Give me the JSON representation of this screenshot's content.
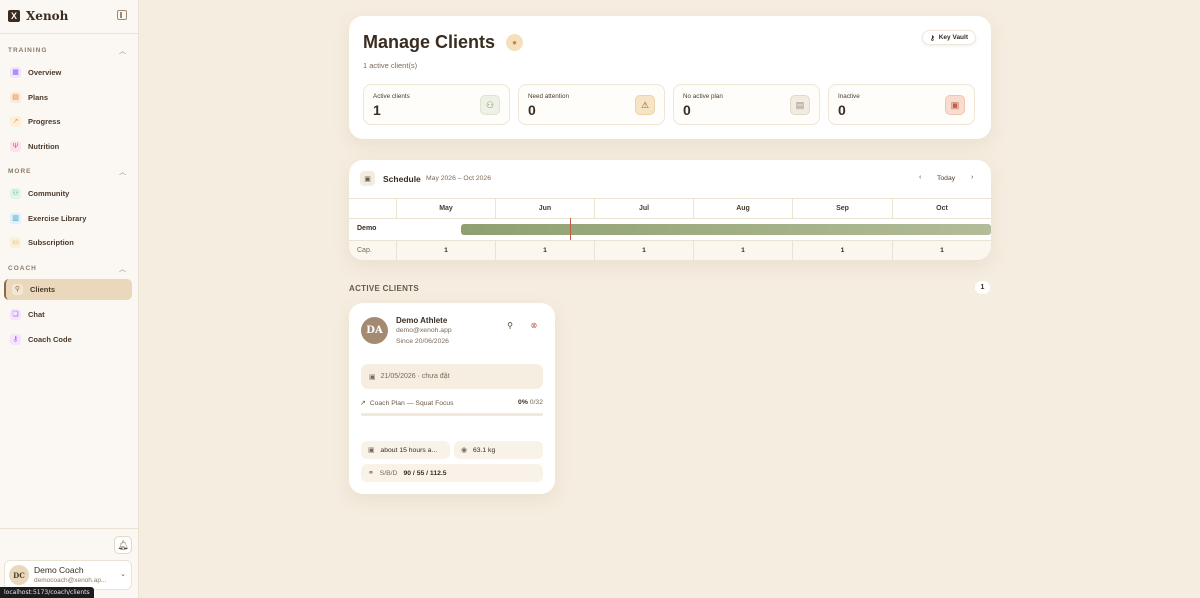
{
  "brand": {
    "name": "Xenoh",
    "logo_letter": "X"
  },
  "sidebar": {
    "sections": [
      {
        "label": "TRAINING",
        "items": [
          {
            "label": "Overview",
            "icon": "grid-icon",
            "color": "#8b5cf6"
          },
          {
            "label": "Plans",
            "icon": "clipboard-icon",
            "color": "#e8823a"
          },
          {
            "label": "Progress",
            "icon": "trending-icon",
            "color": "#e8a23a"
          },
          {
            "label": "Nutrition",
            "icon": "utensils-icon",
            "color": "#e0508a"
          }
        ]
      },
      {
        "label": "MORE",
        "items": [
          {
            "label": "Community",
            "icon": "users-icon",
            "color": "#4caf70"
          },
          {
            "label": "Exercise Library",
            "icon": "book-icon",
            "color": "#3aa0c8"
          },
          {
            "label": "Subscription",
            "icon": "card-icon",
            "color": "#e8a23a"
          }
        ]
      },
      {
        "label": "COACH",
        "items": [
          {
            "label": "Clients",
            "icon": "user-check-icon",
            "color": "#8b6a43",
            "active": true
          },
          {
            "label": "Chat",
            "icon": "chat-icon",
            "color": "#a855f7"
          },
          {
            "label": "Coach Code",
            "icon": "key-icon",
            "color": "#a855f7"
          }
        ]
      }
    ]
  },
  "user": {
    "initials": "DC",
    "name": "Demo Coach",
    "email": "democoach@xenoh.ap..."
  },
  "status_url": "localhost:5173/coach/clients",
  "manage": {
    "title": "Manage Clients",
    "subtitle": "1 active client(s)",
    "key_vault": "Key Vault",
    "stats": [
      {
        "label": "Active clients",
        "value": "1",
        "icon": "users-icon",
        "bg": "#eef1e6",
        "fg": "#7a9a60"
      },
      {
        "label": "Need attention",
        "value": "0",
        "icon": "alert-icon",
        "bg": "#f6e4c6",
        "fg": "#b8802a"
      },
      {
        "label": "No active plan",
        "value": "0",
        "icon": "clipboard-icon",
        "bg": "#f1ebe2",
        "fg": "#9a8a78"
      },
      {
        "label": "Inactive",
        "value": "0",
        "icon": "calendar-icon",
        "bg": "#f7dccf",
        "fg": "#c0604a"
      }
    ]
  },
  "schedule": {
    "title": "Schedule",
    "range": "May 2026 – Oct 2026",
    "today": "Today",
    "months": [
      "May",
      "Jun",
      "Jul",
      "Aug",
      "Sep",
      "Oct"
    ],
    "row_label": "Demo",
    "cap_label": "Cap.",
    "capacities": [
      "1",
      "1",
      "1",
      "1",
      "1",
      "1"
    ]
  },
  "active": {
    "heading": "ACTIVE CLIENTS",
    "count": "1"
  },
  "client": {
    "initials": "DA",
    "name": "Demo Athlete",
    "email": "demo@xenoh.app",
    "since": "Since 20/06/2026",
    "date_status": "21/05/2026 · chưa đặt",
    "plan": "Coach Plan — Squat Focus",
    "plan_pct": "0%",
    "plan_count": "0/32",
    "progress": 0,
    "last_seen": "about 15 hours a...",
    "weight": "63.1 kg",
    "sbd_label": "S/B/D",
    "sbd_value": "90 / 55 / 112.5"
  }
}
